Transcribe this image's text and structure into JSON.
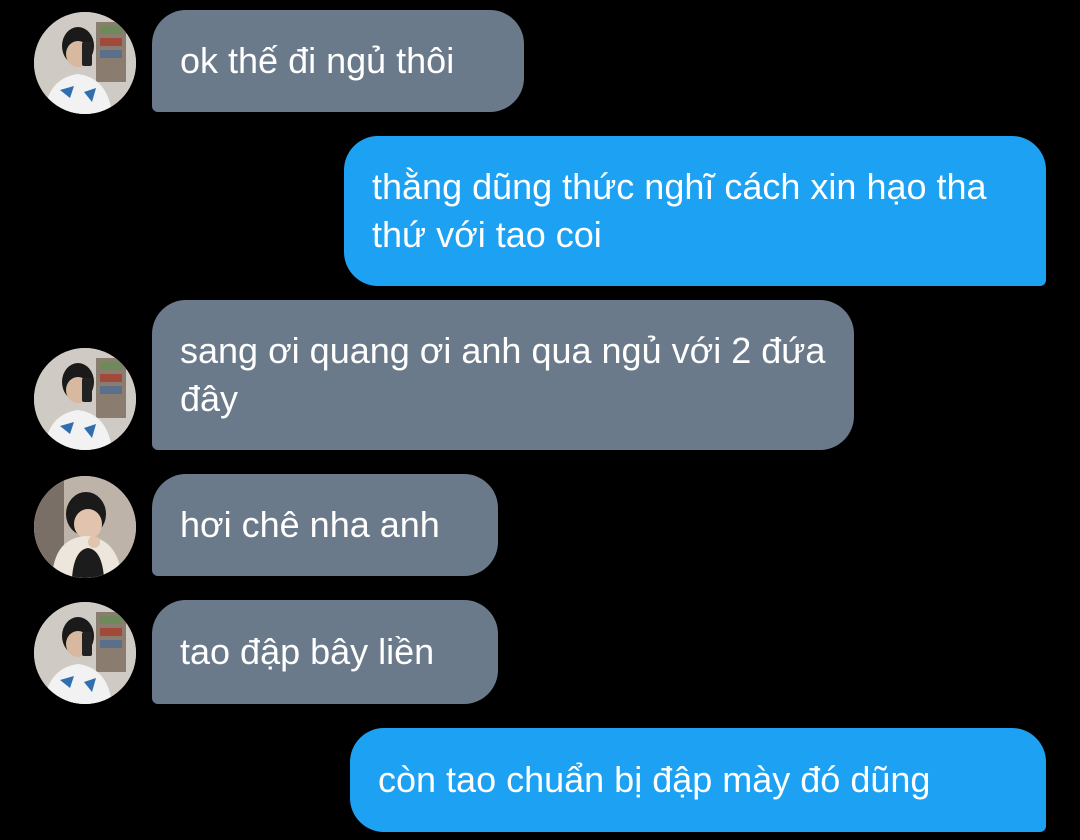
{
  "colors": {
    "background": "#000000",
    "incoming_bubble": "#6b7a8a",
    "outgoing_bubble": "#1da1f2",
    "text": "#ffffff"
  },
  "messages": [
    {
      "direction": "incoming",
      "sender_avatar": "avatar-photo-mirror-selfie",
      "text": "ok thế đi ngủ thôi"
    },
    {
      "direction": "outgoing",
      "text": "thằng dũng thức nghĩ cách xin hạo tha thứ với tao coi"
    },
    {
      "direction": "incoming",
      "sender_avatar": "avatar-photo-mirror-selfie",
      "text": "sang ơi quang ơi anh qua ngủ với 2 đứa đây"
    },
    {
      "direction": "incoming",
      "sender_avatar": "avatar-photo-hoodie",
      "text": "hơi chê nha anh"
    },
    {
      "direction": "incoming",
      "sender_avatar": "avatar-photo-mirror-selfie",
      "text": "tao đập bây liền"
    },
    {
      "direction": "outgoing",
      "text": "còn tao chuẩn bị đập mày đó dũng"
    }
  ]
}
